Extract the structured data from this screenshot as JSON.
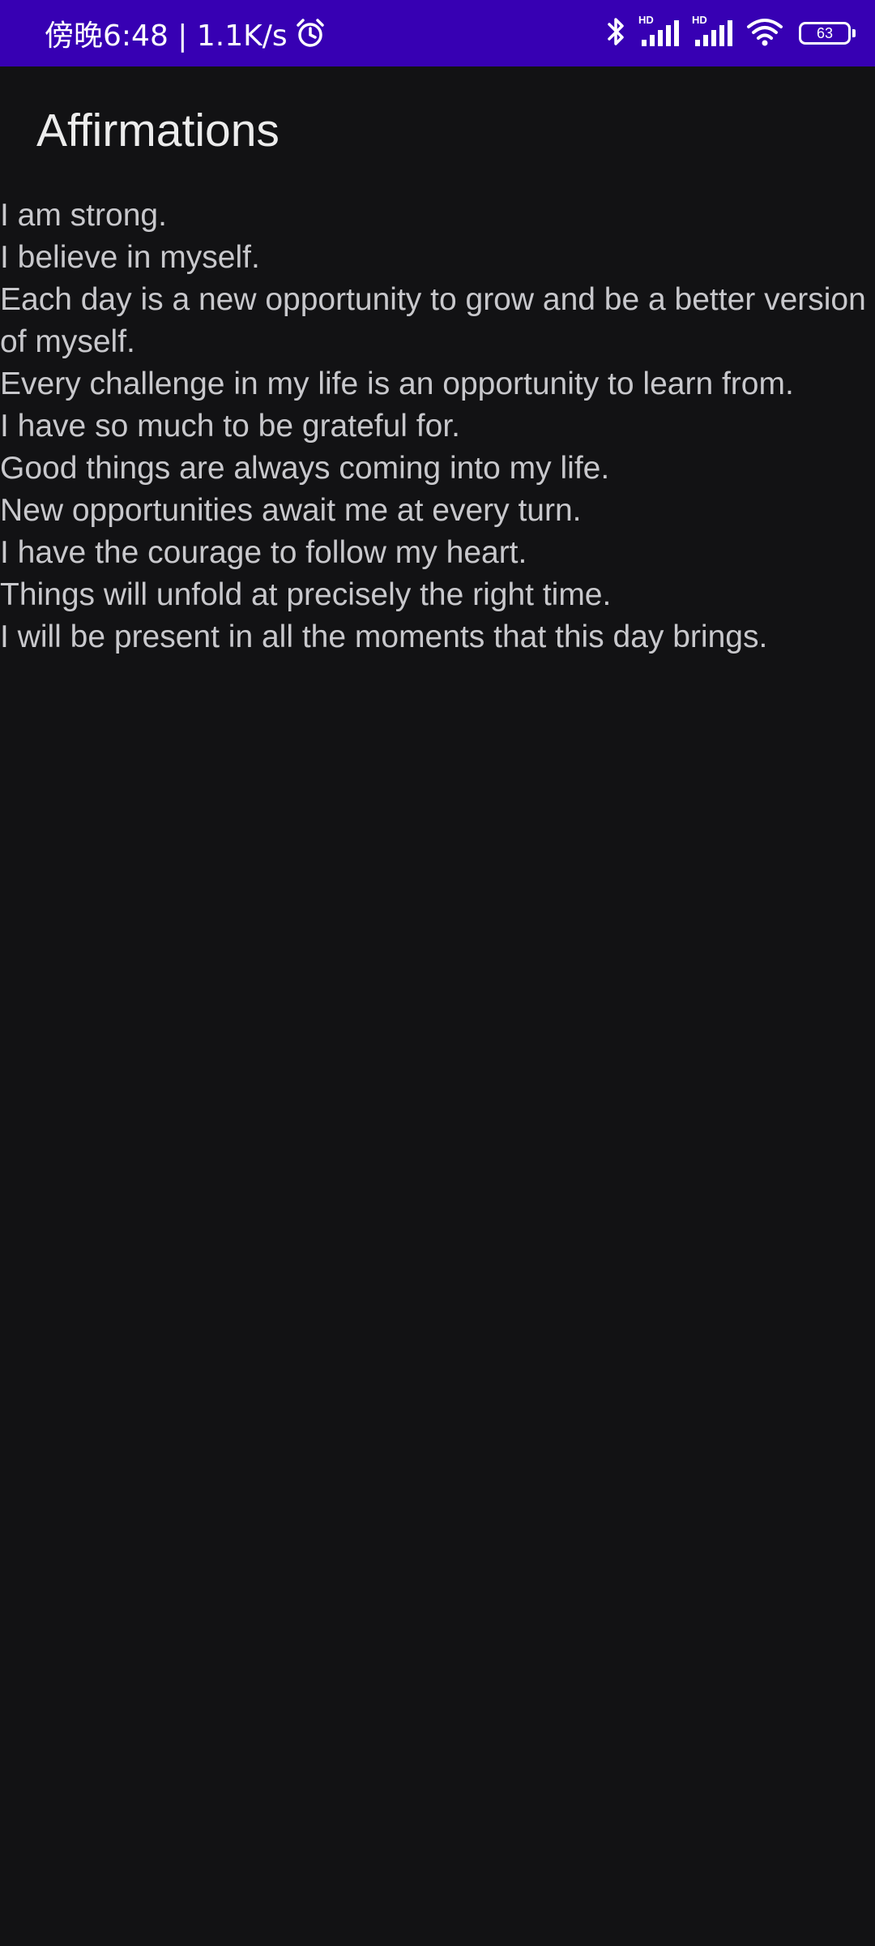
{
  "status_bar": {
    "time": "傍晚6:48 | 1.1K/s",
    "icons": [
      "alarm-icon",
      "bluetooth-icon",
      "signal-icon",
      "signal-icon",
      "wifi-icon",
      "battery-icon"
    ],
    "hd_label_1": "HD",
    "hd_label_2": "HD",
    "battery_level": "63",
    "background_color": "#3700b3"
  },
  "app_bar": {
    "title": "Affirmations"
  },
  "affirmations": [
    "I am strong.",
    "I believe in myself.",
    "Each day is a new opportunity to grow and be a better version of myself.",
    "Every challenge in my life is an opportunity to learn from.",
    "I have so much to be grateful for.",
    "Good things are always coming into my life.",
    "New opportunities await me at every turn.",
    "I have the courage to follow my heart.",
    "Things will unfold at precisely the right time.",
    "I will be present in all the moments that this day brings."
  ],
  "colors": {
    "background": "#121214",
    "title_text": "#ececec",
    "body_text": "#c8c8cc"
  }
}
